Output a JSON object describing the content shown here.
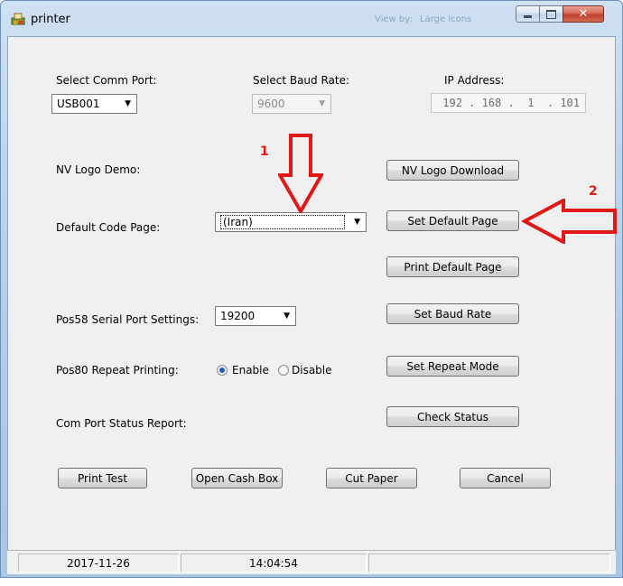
{
  "window": {
    "title": "printer",
    "ghost_text_1": "View by:",
    "ghost_text_2": "Large icons"
  },
  "form": {
    "comm_port": {
      "label": "Select Comm Port:",
      "value": "USB001"
    },
    "baud_rate": {
      "label": "Select Baud Rate:",
      "value": "9600"
    },
    "ip": {
      "label": "IP Address:",
      "value": "192 . 168 .  1  . 101"
    },
    "nv_logo": {
      "label": "NV Logo Demo:",
      "button": "NV Logo Download"
    },
    "code_page": {
      "label": "Default Code Page:",
      "value": "(Iran)",
      "set_button": "Set Default Page",
      "print_button": "Print Default Page"
    },
    "pos58": {
      "label": "Pos58 Serial Port Settings:",
      "value": "19200",
      "button": "Set Baud Rate"
    },
    "pos80": {
      "label": "Pos80 Repeat Printing:",
      "enable": "Enable",
      "disable": "Disable",
      "selected": "Enable",
      "button": "Set Repeat Mode"
    },
    "status": {
      "label": "Com Port Status Report:",
      "button": "Check Status"
    }
  },
  "actions": {
    "print_test": "Print Test",
    "open_cash_box": "Open Cash Box",
    "cut_paper": "Cut Paper",
    "cancel": "Cancel"
  },
  "statusbar": {
    "date": "2017-11-26",
    "time": "14:04:54",
    "extra": ""
  },
  "annotations": {
    "marker_1": "1",
    "marker_2": "2",
    "color": "#e01818"
  }
}
